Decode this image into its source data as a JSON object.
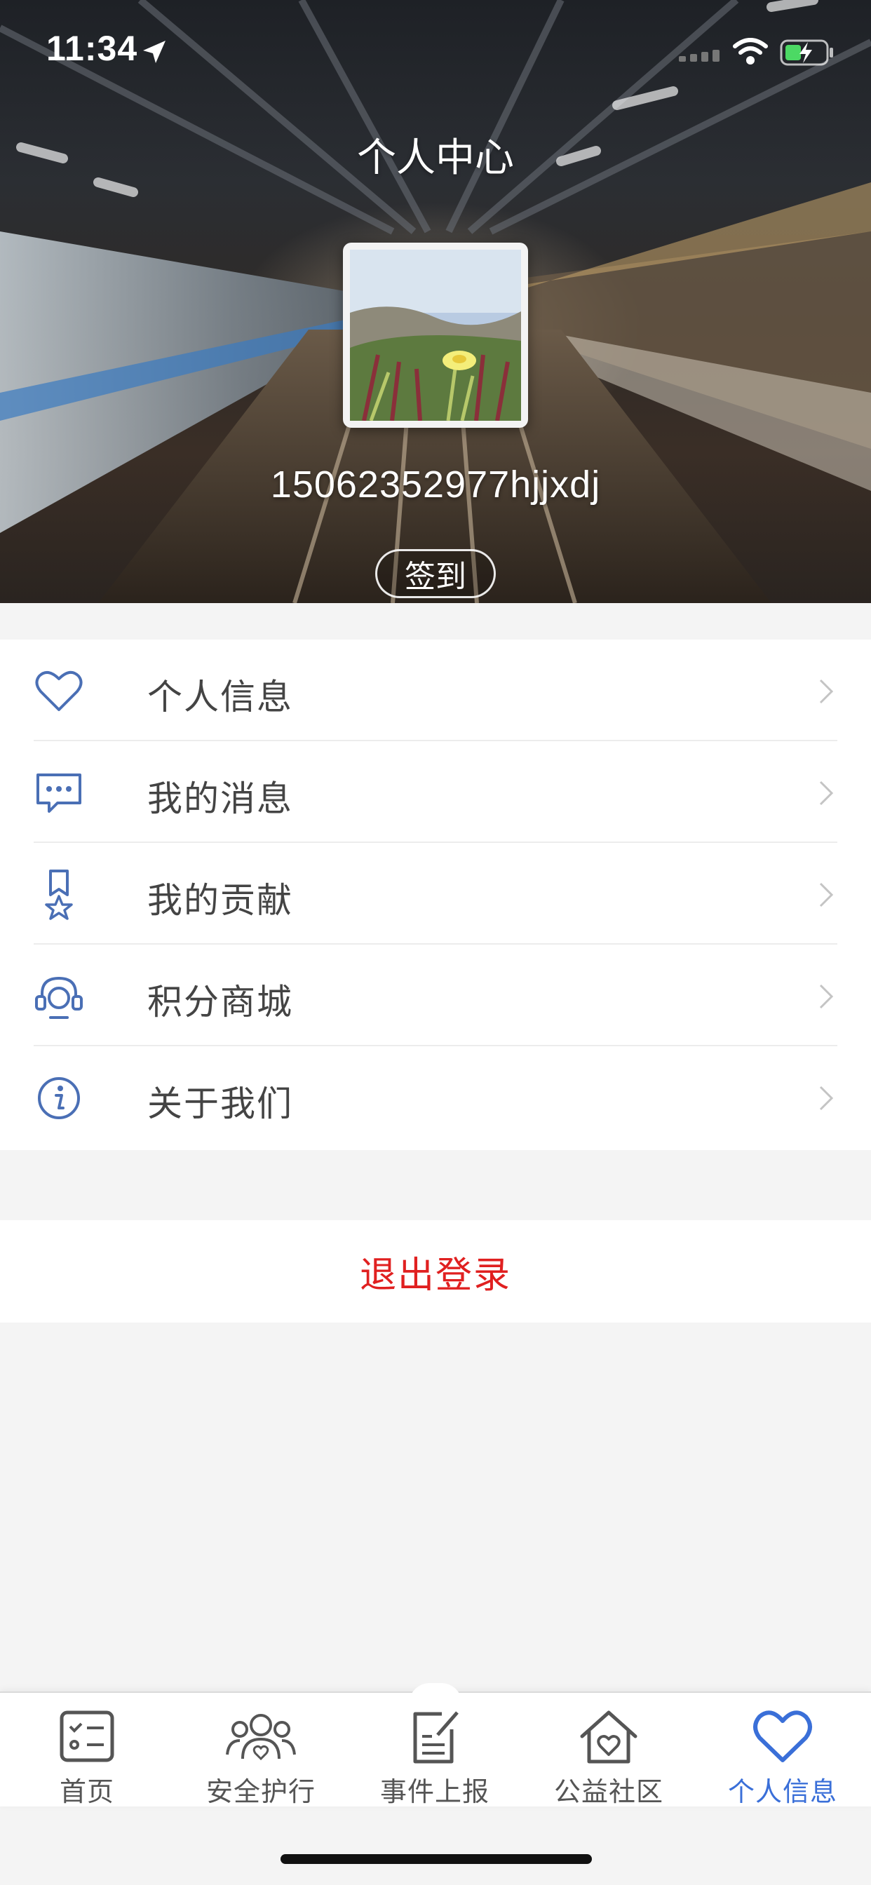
{
  "status_bar": {
    "time": "11:34"
  },
  "header": {
    "title": "个人中心",
    "username": "15062352977hjjxdj",
    "checkin_label": "签到"
  },
  "menu": {
    "items": [
      {
        "label": "个人信息",
        "icon": "heart-icon"
      },
      {
        "label": "我的消息",
        "icon": "message-bubble-icon"
      },
      {
        "label": "我的贡献",
        "icon": "ribbon-star-icon"
      },
      {
        "label": "积分商城",
        "icon": "headset-icon"
      },
      {
        "label": "关于我们",
        "icon": "info-icon"
      }
    ]
  },
  "logout_label": "退出登录",
  "tab_bar": {
    "items": [
      {
        "label": "首页",
        "icon": "checklist-icon",
        "active": false
      },
      {
        "label": "安全护行",
        "icon": "people-heart-icon",
        "active": false
      },
      {
        "label": "事件上报",
        "icon": "report-edit-icon",
        "active": false
      },
      {
        "label": "公益社区",
        "icon": "house-heart-icon",
        "active": false
      },
      {
        "label": "个人信息",
        "icon": "heart-icon",
        "active": true
      }
    ]
  },
  "colors": {
    "accent": "#3a6fd8",
    "icon_blue": "#4a6fb5",
    "logout_red": "#e02020",
    "background": "#f4f4f4"
  }
}
